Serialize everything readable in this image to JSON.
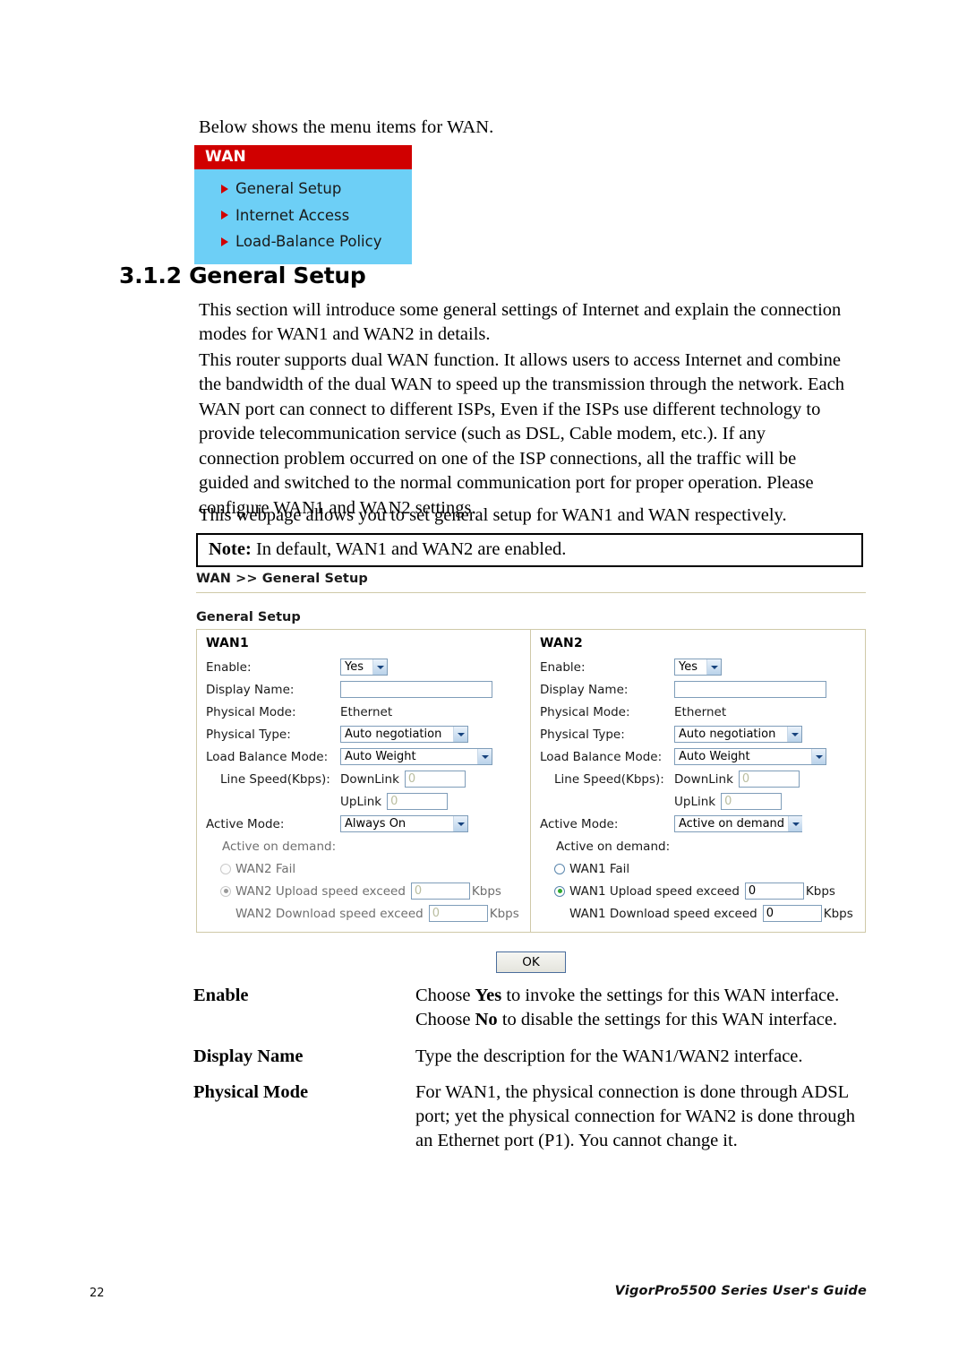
{
  "intro": "Below shows the menu items for WAN.",
  "wan_menu": {
    "title": "WAN",
    "items": [
      {
        "label": "General Setup"
      },
      {
        "label": "Internet Access"
      },
      {
        "label": "Load-Balance Policy"
      }
    ]
  },
  "section": {
    "heading": "3.1.2 General Setup",
    "paragraph1": "This section will introduce some general settings of Internet and explain the connection modes for WAN1 and WAN2 in details.",
    "paragraph2": "This router supports dual WAN function. It allows users to access Internet and combine the bandwidth of the dual WAN to speed up the transmission through the network. Each WAN port can connect to different ISPs, Even if the ISPs use different technology to provide telecommunication service (such as DSL, Cable modem, etc.). If any connection problem occurred on one of the ISP connections, all the traffic will be guided and switched to the normal communication port for proper operation. Please configure WAN1 and WAN2 settings.",
    "paragraph3": "This webpage allows you to set general setup for WAN1 and WAN respectively."
  },
  "note": {
    "prefix": "Note:",
    "text": "In default, WAN1 and WAN2 are enabled."
  },
  "screenshot": {
    "breadcrumb": "WAN >> General Setup",
    "panel_title": "General Setup",
    "ok_label": "OK",
    "labels": {
      "enable": "Enable:",
      "display_name": "Display Name:",
      "physical_mode": "Physical Mode:",
      "physical_type": "Physical Type:",
      "load_balance_mode": "Load Balance Mode:",
      "line_speed": "Line Speed(Kbps):",
      "downlink": "DownLink",
      "uplink": "UpLink",
      "active_mode": "Active Mode:",
      "active_on_demand": "Active on demand:",
      "kbps": "Kbps"
    },
    "wan1": {
      "title": "WAN1",
      "enable": "Yes",
      "display_name": "",
      "physical_mode": "Ethernet",
      "physical_type": "Auto negotiation",
      "load_balance_mode": "Auto Weight",
      "downlink": "0",
      "uplink": "0",
      "active_mode": "Always On",
      "radio_fail_label": "WAN2 Fail",
      "radio_upload_label": "WAN2 Upload speed exceed",
      "upload_value": "0",
      "download_label": "WAN2 Download speed exceed",
      "download_value": "0"
    },
    "wan2": {
      "title": "WAN2",
      "enable": "Yes",
      "display_name": "",
      "physical_mode": "Ethernet",
      "physical_type": "Auto negotiation",
      "load_balance_mode": "Auto Weight",
      "downlink": "0",
      "uplink": "0",
      "active_mode": "Active on demand",
      "radio_fail_label": "WAN1 Fail",
      "radio_upload_label": "WAN1 Upload speed exceed",
      "upload_value": "0",
      "download_label": "WAN1 Download speed exceed",
      "download_value": "0"
    }
  },
  "definitions": [
    {
      "term": "Enable",
      "line1_a": "Choose ",
      "line1_b": "Yes",
      "line1_c": " to invoke the settings for this WAN interface.",
      "line2_a": "Choose ",
      "line2_b": "No",
      "line2_c": " to disable the settings for this WAN interface."
    },
    {
      "term": "Display Name",
      "desc": "Type the description for the WAN1/WAN2 interface."
    },
    {
      "term": "Physical Mode",
      "desc": "For WAN1, the physical connection is done through ADSL port; yet the physical connection for WAN2 is done through an Ethernet port (P1). You cannot change it."
    }
  ],
  "footer": {
    "page_number": "22",
    "guide": "VigorPro5500 Series User's Guide"
  },
  "colors": {
    "menu_header": "#d00000",
    "menu_body": "#6dcff6",
    "table_border": "#cfc9a8",
    "control_border": "#7f9db9"
  }
}
